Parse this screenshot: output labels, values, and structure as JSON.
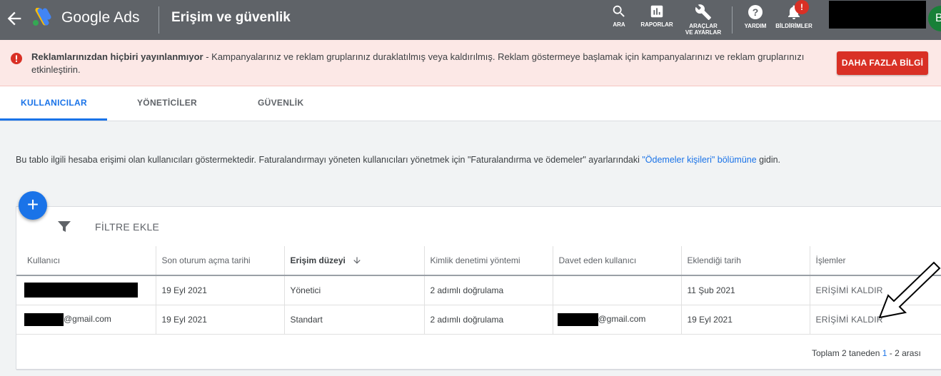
{
  "header": {
    "brand": "Google Ads",
    "page_title": "Erişim ve güvenlik",
    "tools": [
      {
        "icon": "search-icon",
        "label": "ARA"
      },
      {
        "icon": "bar-chart-icon",
        "label": "RAPORLAR"
      },
      {
        "icon": "wrench-icon",
        "label_line1": "ARAÇLAR",
        "label_line2": "VE AYARLAR"
      },
      {
        "icon": "help-icon",
        "label": "YARDIM"
      },
      {
        "icon": "bell-icon",
        "label": "BİLDİRİMLER"
      }
    ],
    "notification_badge": "!",
    "avatar_letter": "B"
  },
  "banner": {
    "title": "Reklamlarınızdan hiçbiri yayınlanmıyor",
    "message": " - Kampanyalarınız ve reklam gruplarınız duraklatılmış veya kaldırılmış. Reklam göstermeye başlamak için kampanyalarınızı ve reklam gruplarınızı etkinleştirin.",
    "button": "DAHA FAZLA BİLGİ"
  },
  "tabs": [
    "KULLANICILAR",
    "YÖNETİCİLER",
    "GÜVENLİK"
  ],
  "description": {
    "before": "Bu tablo ilgili hesaba erişimi olan kullanıcıları göstermektedir. Faturalandırmayı yöneten kullanıcıları yönetmek için \"Faturalandırma ve ödemeler\" ayarlarındaki ",
    "link": "\"Ödemeler kişileri\" bölümüne",
    "after": " gidin."
  },
  "toolbar": {
    "add_symbol": "+",
    "filter_label": "FİLTRE EKLE"
  },
  "table": {
    "columns": [
      "Kullanıcı",
      "Son oturum açma tarihi",
      "Erişim düzeyi",
      "Kimlik denetimi yöntemi",
      "Davet eden kullanıcı",
      "Eklendiği tarih",
      "İşlemler"
    ],
    "rows": [
      {
        "user_suffix": "",
        "last_login": "19 Eyl 2021",
        "access": "Yönetici",
        "auth": "2 adımlı doğrulama",
        "inviter_suffix": "",
        "added": "11 Şub 2021",
        "action": "ERİŞİMİ KALDIR"
      },
      {
        "user_suffix": "@gmail.com",
        "last_login": "19 Eyl 2021",
        "access": "Standart",
        "auth": "2 adımlı doğrulama",
        "inviter_suffix": "@gmail.com",
        "added": "19 Eyl 2021",
        "action": "ERİŞİMİ KALDIR"
      }
    ]
  },
  "pagination": {
    "prefix": "Toplam 2 taneden ",
    "start": "1",
    "middle": " - ",
    "end": "2",
    "suffix": " arası"
  },
  "colors": {
    "topbar": "#5f6368",
    "accent": "#1a73e8",
    "banner_bg": "#fce8e6",
    "error": "#d93025"
  }
}
